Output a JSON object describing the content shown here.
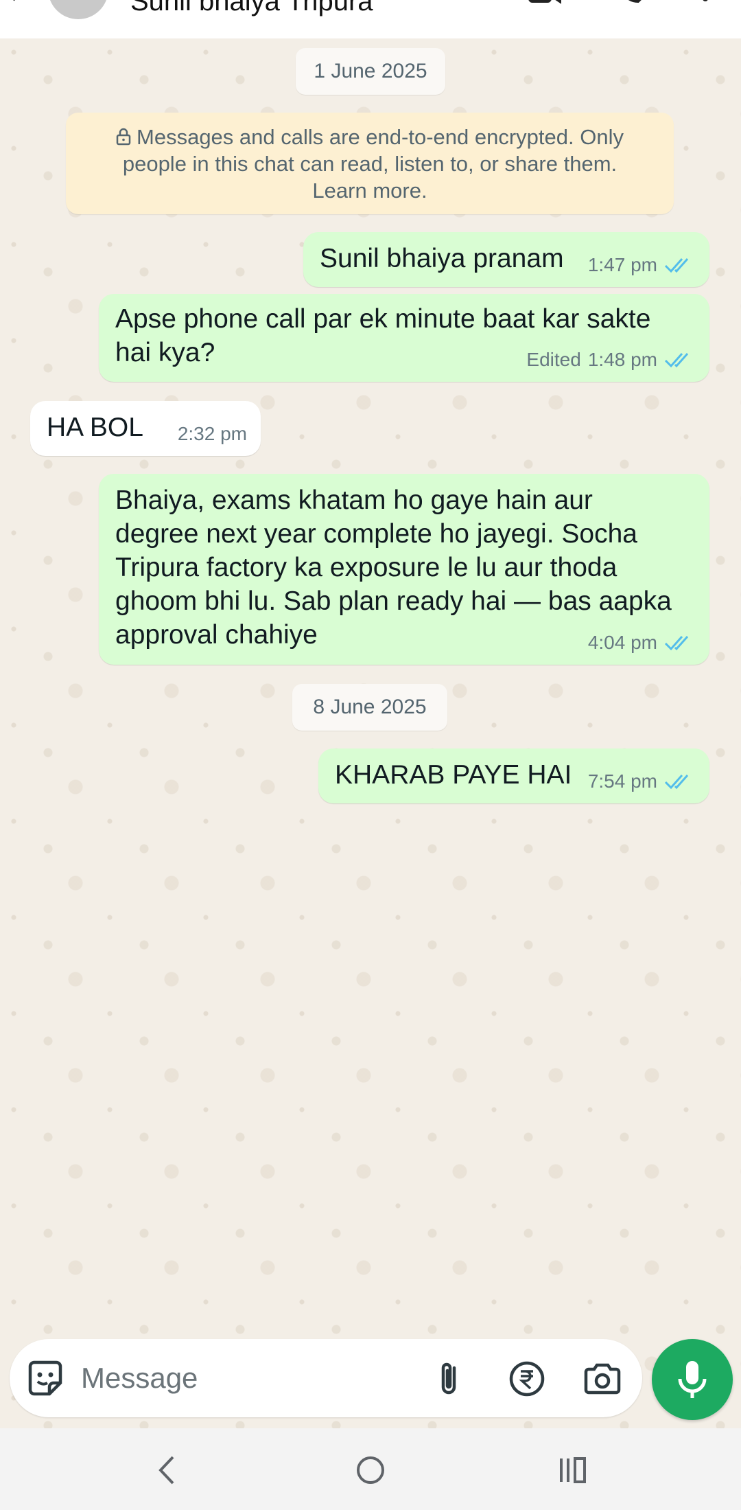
{
  "header": {
    "contact_name": "Sunil bhaiya Tripura"
  },
  "chat": {
    "dates": [
      "1 June 2025",
      "8 June 2025"
    ],
    "encryption_notice": "Messages and calls are end-to-end encrypted. Only people in this chat can read, listen to, or share them. Learn more.",
    "messages": [
      {
        "direction": "out",
        "lines": [
          "Sunil bhaiya pranam"
        ],
        "time": "1:47 pm",
        "edited": "",
        "status": "read"
      },
      {
        "direction": "out",
        "lines": [
          "Apse phone call par ek minute baat kar sakte",
          "hai kya?"
        ],
        "time": "1:48 pm",
        "edited": "Edited",
        "status": "read"
      },
      {
        "direction": "in",
        "lines": [
          "HA BOL"
        ],
        "time": "2:32 pm",
        "edited": "",
        "status": ""
      },
      {
        "direction": "out",
        "lines": [
          "Bhaiya, exams khatam ho gaye hain aur",
          "degree next year complete ho jayegi. Socha",
          "Tripura factory ka exposure le lu aur thoda",
          "ghoom bhi lu. Sab plan ready hai — bas aapka",
          "approval chahiye"
        ],
        "time": "4:04 pm",
        "edited": "",
        "status": "read"
      },
      {
        "direction": "out",
        "lines": [
          "KHARAB PAYE HAI"
        ],
        "time": "7:54 pm",
        "edited": "",
        "status": "read"
      }
    ]
  },
  "composer": {
    "placeholder": "Message"
  },
  "colors": {
    "outgoing_bubble": "#d9fdd3",
    "incoming_bubble": "#ffffff",
    "read_ticks": "#53bdeb",
    "mic_button": "#1daa61",
    "chat_background": "#f3eee6"
  },
  "icons": [
    "back-arrow-icon",
    "avatar",
    "video-call-icon",
    "voice-call-icon",
    "more-options-icon",
    "lock-icon",
    "double-tick-icon",
    "emoji-sticker-icon",
    "attach-icon",
    "rupee-payment-icon",
    "camera-icon",
    "microphone-icon",
    "nav-back-icon",
    "nav-home-icon",
    "nav-recents-icon"
  ]
}
